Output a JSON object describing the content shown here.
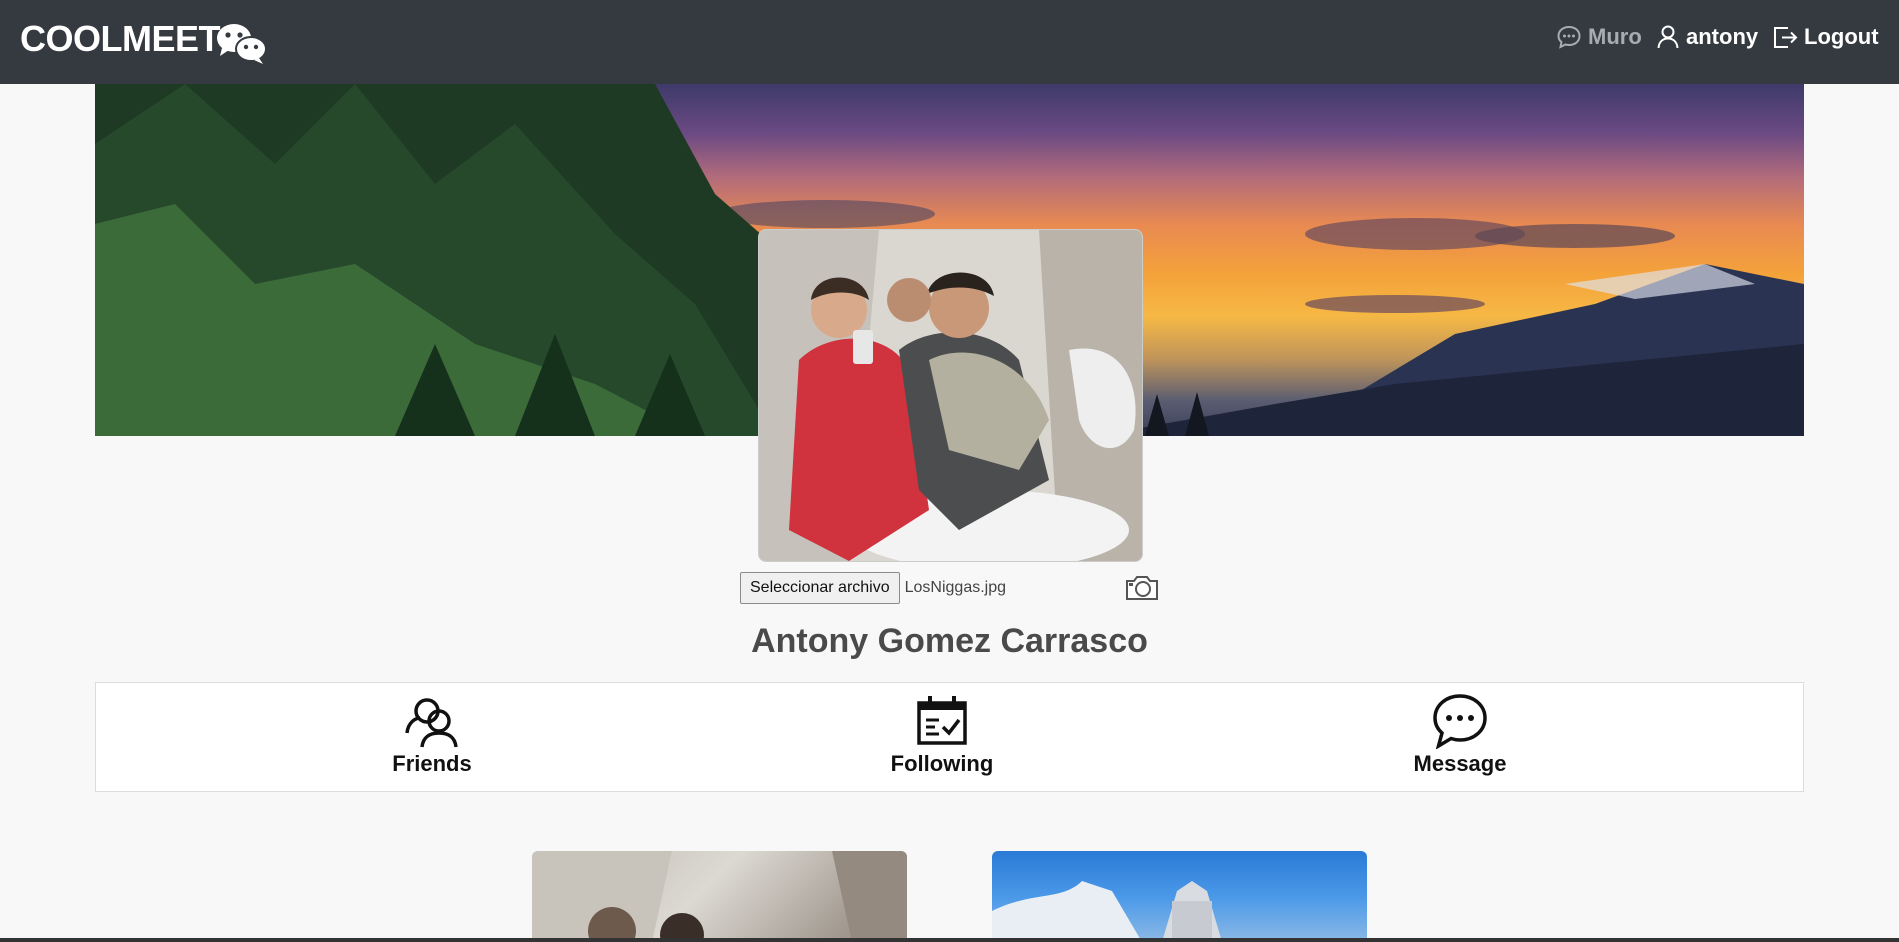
{
  "navbar": {
    "brand": "COOLMEET",
    "brand_icon": "wechat-icon",
    "items": [
      {
        "label": "Muro",
        "icon": "chat-icon",
        "active": false
      },
      {
        "label": "antony",
        "icon": "user-icon"
      },
      {
        "label": "Logout",
        "icon": "logout-icon"
      }
    ]
  },
  "profile": {
    "file_button_label": "Seleccionar archivo",
    "file_name": "LosNiggas.jpg",
    "camera_icon": "camera-icon",
    "full_name": "Antony Gomez Carrasco"
  },
  "actions": [
    {
      "label": "Friends",
      "icon": "friends-icon"
    },
    {
      "label": "Following",
      "icon": "calendar-check-icon"
    },
    {
      "label": "Message",
      "icon": "message-dots-icon"
    }
  ],
  "colors": {
    "navbar_bg": "#343a40",
    "muro_text": "#a8abaf",
    "page_bg": "#f8f8f8"
  }
}
